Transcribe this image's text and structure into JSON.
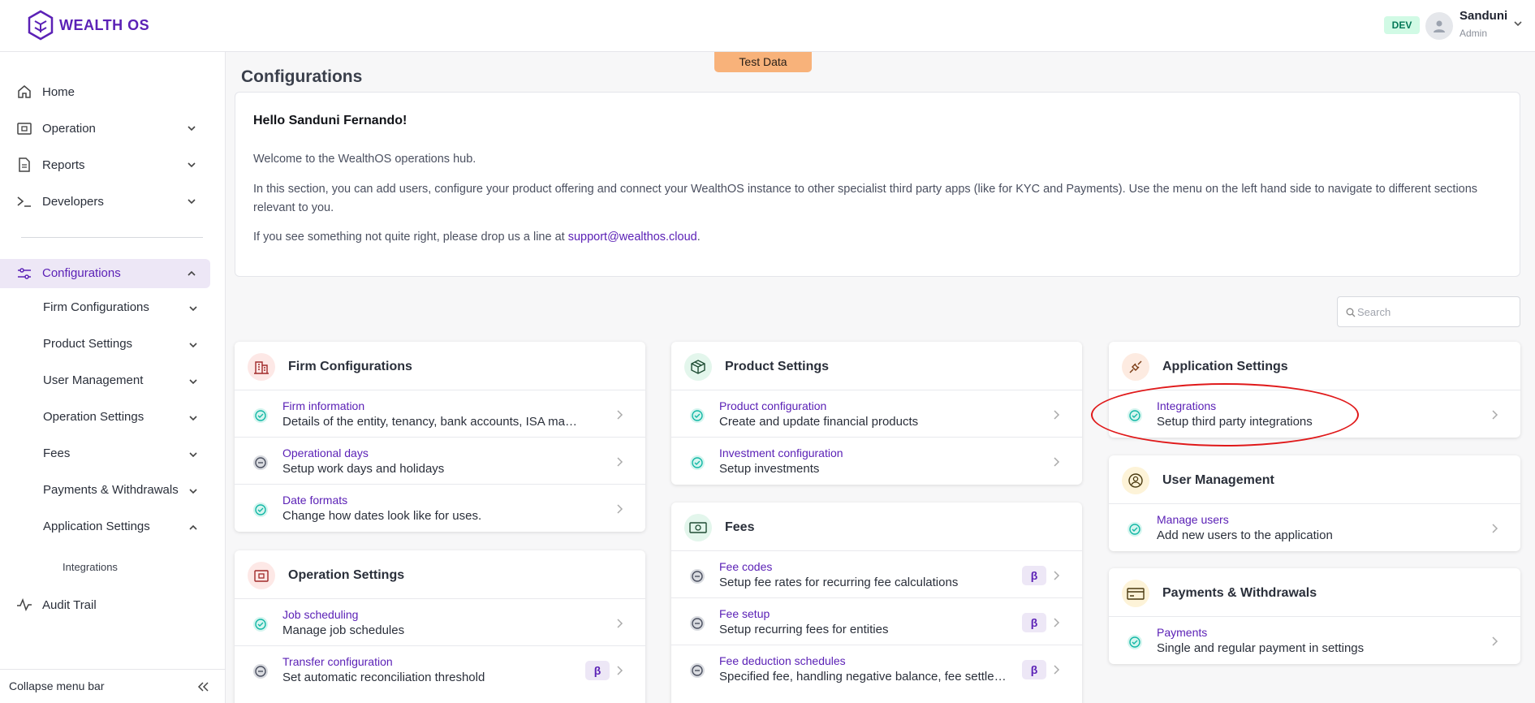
{
  "header": {
    "logo_text": "WEALTH OS",
    "env_badge": "DEV",
    "user_name": "Sanduni",
    "user_role": "Admin"
  },
  "sidebar": {
    "items": [
      {
        "label": "Home",
        "icon": "home-icon"
      },
      {
        "label": "Operation",
        "icon": "operation-icon"
      },
      {
        "label": "Reports",
        "icon": "reports-icon"
      },
      {
        "label": "Developers",
        "icon": "terminal-icon"
      }
    ],
    "active": {
      "label": "Configurations",
      "icon": "sliders-icon"
    },
    "sub_items": [
      "Firm Configurations",
      "Product Settings",
      "User Management",
      "Operation Settings",
      "Fees",
      "Payments & Withdrawals",
      "Application Settings"
    ],
    "sub_sub_item": "Integrations",
    "audit": {
      "label": "Audit Trail",
      "icon": "activity-icon"
    },
    "collapse_label": "Collapse menu bar"
  },
  "main": {
    "test_data_label": "Test Data",
    "title": "Configurations",
    "welcome": {
      "greeting": "Hello Sanduni Fernando!",
      "line1": "Welcome to the WealthOS operations hub.",
      "line2": "In this section, you can add users, configure your product offering and connect your WealthOS instance to other specialist third party apps (like for KYC and Payments). Use the menu on the left hand side to navigate to different sections relevant to you.",
      "line3_prefix": "If you see something not quite right, please drop us a line at ",
      "support_email": "support@wealthos.cloud",
      "line3_suffix": "."
    },
    "search_placeholder": "Search"
  },
  "cards": {
    "firm": {
      "title": "Firm Configurations",
      "rows": [
        {
          "title": "Firm information",
          "desc": "Details of the entity, tenancy, bank accounts, ISA manager",
          "status": "done"
        },
        {
          "title": "Operational days",
          "desc": "Setup work days and holidays",
          "status": "pending"
        },
        {
          "title": "Date formats",
          "desc": "Change how dates look like for uses.",
          "status": "done"
        }
      ]
    },
    "operation": {
      "title": "Operation Settings",
      "rows": [
        {
          "title": "Job scheduling",
          "desc": "Manage job schedules",
          "status": "done"
        },
        {
          "title": "Transfer configuration",
          "desc": "Set automatic reconciliation threshold",
          "status": "pending",
          "badge": "β"
        }
      ]
    },
    "product": {
      "title": "Product Settings",
      "rows": [
        {
          "title": "Product configuration",
          "desc": "Create and update financial products",
          "status": "done"
        },
        {
          "title": "Investment configuration",
          "desc": "Setup investments",
          "status": "done"
        }
      ]
    },
    "fees": {
      "title": "Fees",
      "rows": [
        {
          "title": "Fee codes",
          "desc": "Setup fee rates for recurring fee calculations",
          "status": "pending",
          "badge": "β"
        },
        {
          "title": "Fee setup",
          "desc": "Setup recurring fees for entities",
          "status": "pending",
          "badge": "β"
        },
        {
          "title": "Fee deduction schedules",
          "desc": "Specified fee, handling negative balance, fee settleme...",
          "status": "pending",
          "badge": "β"
        }
      ]
    },
    "application": {
      "title": "Application Settings",
      "rows": [
        {
          "title": "Integrations",
          "desc": "Setup third party integrations",
          "status": "done"
        }
      ]
    },
    "users": {
      "title": "User Management",
      "rows": [
        {
          "title": "Manage users",
          "desc": "Add new users to the application",
          "status": "done"
        }
      ]
    },
    "payments": {
      "title": "Payments & Withdrawals",
      "rows": [
        {
          "title": "Payments",
          "desc": "Single and regular payment in settings",
          "status": "done"
        }
      ]
    }
  },
  "colors": {
    "brand": "#5b21b6",
    "active_bg": "#ede7f6",
    "status_done": "#14b8a6",
    "status_pending": "#6b7280",
    "test_data_bg": "#f8b27a",
    "annotation": "#e0191a"
  }
}
